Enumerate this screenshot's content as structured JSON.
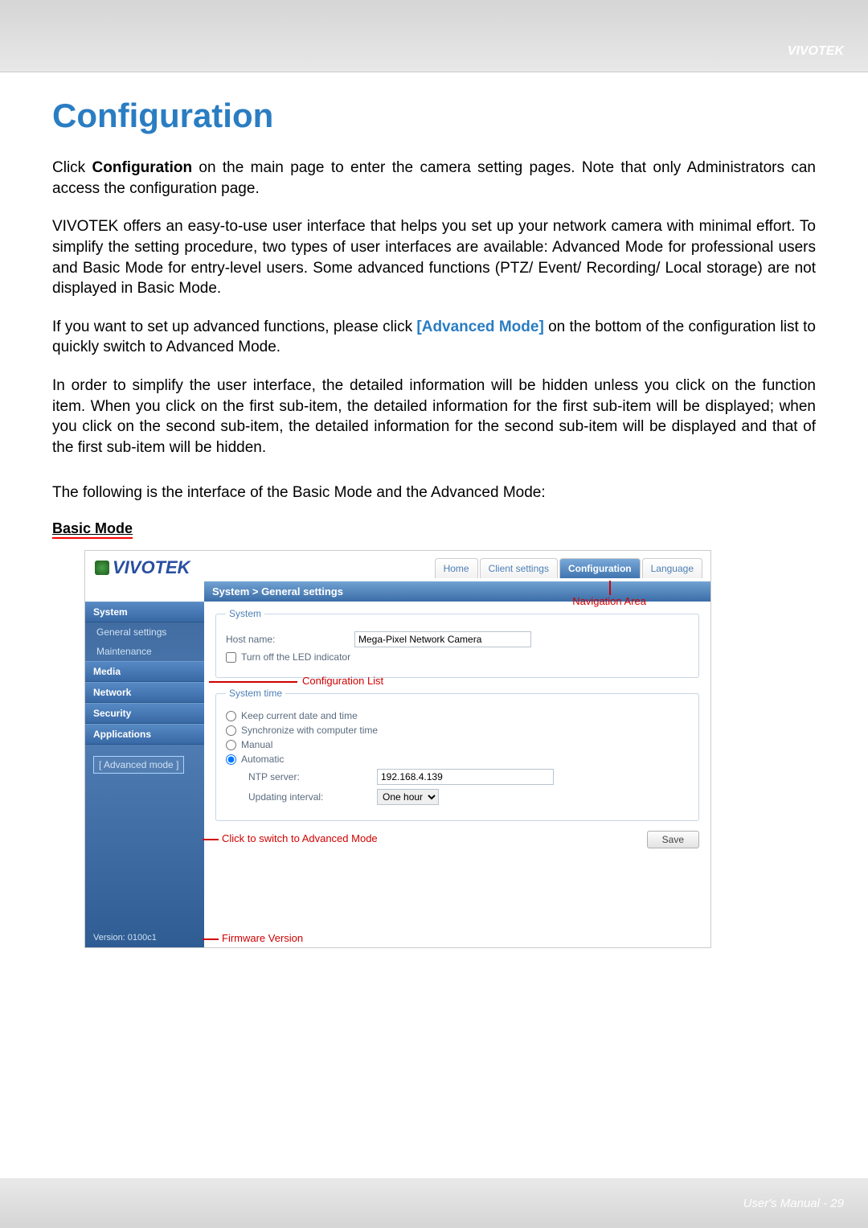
{
  "header_brand": "VIVOTEK",
  "title": "Configuration",
  "p1_prefix": "Click ",
  "p1_bold": "Configuration",
  "p1_rest": " on the main page to enter the camera setting pages. Note that only Administrators can access the configuration page.",
  "p2": "VIVOTEK offers an easy-to-use user interface that helps you set up your network camera with minimal effort. To simplify the setting procedure, two types of user interfaces are available: Advanced Mode for professional users and Basic Mode for entry-level users. Some advanced functions (PTZ/ Event/ Recording/ Local storage) are not displayed in Basic Mode.",
  "p3_prefix": "If you want to set up advanced functions, please click ",
  "p3_link": "[Advanced Mode]",
  "p3_rest": " on the bottom of the configuration list to quickly switch to Advanced Mode.",
  "p4": "In order to simplify the user interface, the detailed information will be hidden unless you click on the function item. When you click on the first sub-item, the detailed information for the first sub-item will be displayed; when you click on the second sub-item, the detailed information for the second sub-item will be displayed and that of the first sub-item will be hidden.",
  "p5": "The following is the interface of the Basic Mode and the Advanced Mode:",
  "section_label": "Basic Mode",
  "logo_text": "VIVOTEK",
  "tabs": {
    "home": "Home",
    "client": "Client settings",
    "config": "Configuration",
    "lang": "Language"
  },
  "breadcrumb": "System  >  General settings",
  "sidebar": {
    "system": "System",
    "general": "General settings",
    "maintenance": "Maintenance",
    "media": "Media",
    "network": "Network",
    "security": "Security",
    "applications": "Applications"
  },
  "adv_mode": "[ Advanced mode ]",
  "version": "Version: 0100c1",
  "system_panel": {
    "legend": "System",
    "host_label": "Host name:",
    "host_value": "Mega-Pixel Network Camera",
    "led_label": "Turn off the LED indicator"
  },
  "time_panel": {
    "legend": "System time",
    "keep": "Keep current date and time",
    "sync": "Synchronize with computer time",
    "manual": "Manual",
    "auto": "Automatic",
    "ntp_label": "NTP server:",
    "ntp_value": "192.168.4.139",
    "interval_label": "Updating interval:",
    "interval_value": "One hour"
  },
  "save_label": "Save",
  "annotations": {
    "nav": "Navigation Area",
    "conf_list": "Configuration List",
    "switch": "Click to switch to Advanced Mode",
    "fw": "Firmware Version"
  },
  "footer": "User's Manual - 29"
}
